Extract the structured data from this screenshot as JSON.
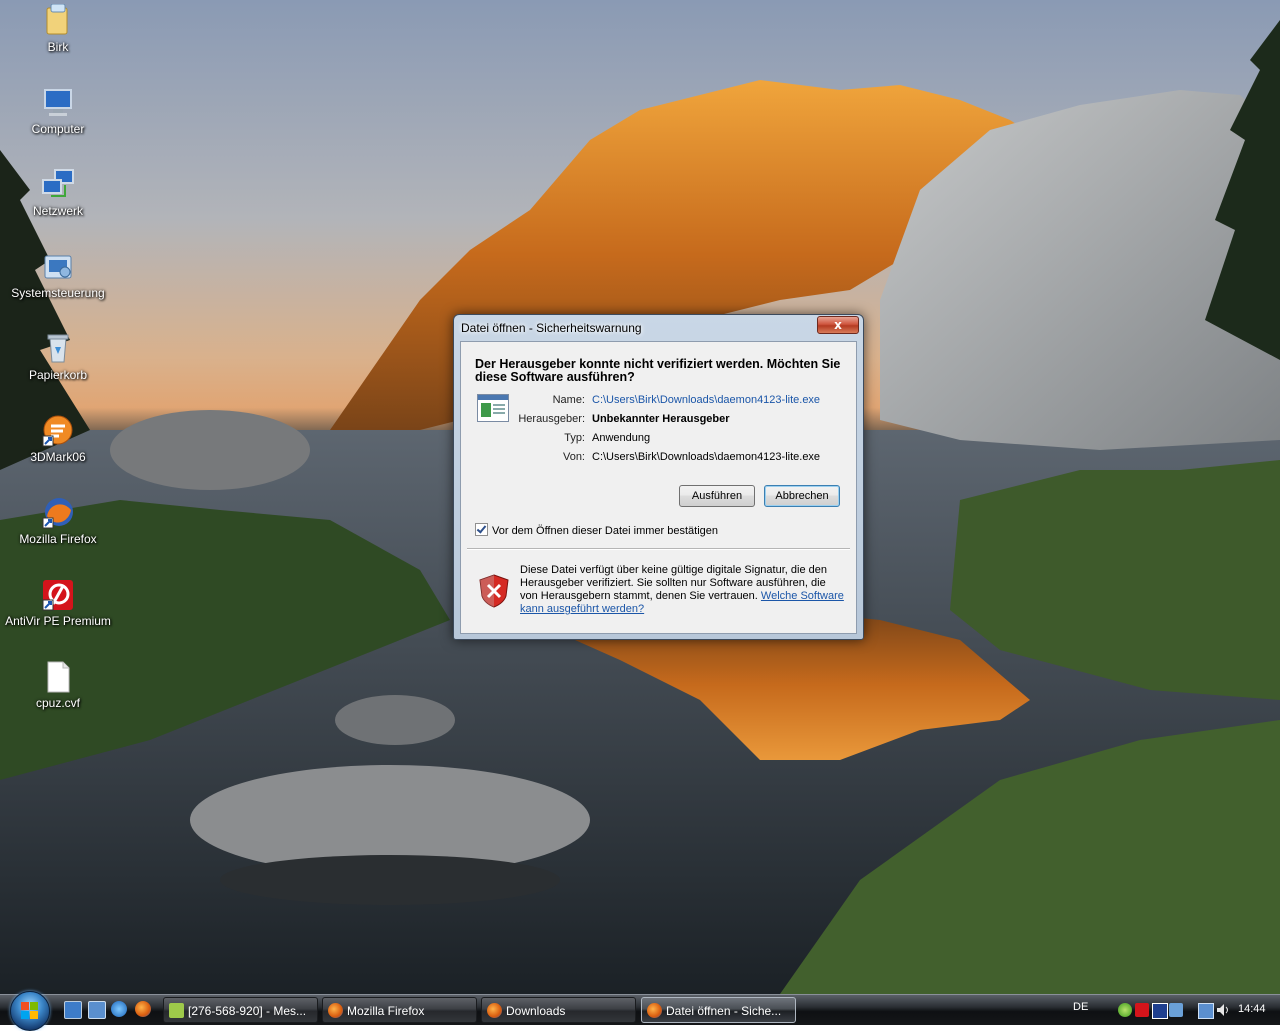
{
  "desktop": {
    "icons": [
      {
        "label": "Birk",
        "icon": "user-folder-icon"
      },
      {
        "label": "Computer",
        "icon": "computer-icon"
      },
      {
        "label": "Netzwerk",
        "icon": "network-icon"
      },
      {
        "label": "Systemsteuerung",
        "icon": "control-panel-icon"
      },
      {
        "label": "Papierkorb",
        "icon": "recycle-bin-icon"
      },
      {
        "label": "3DMark06",
        "icon": "3dmark-shortcut-icon"
      },
      {
        "label": "Mozilla Firefox",
        "icon": "firefox-shortcut-icon"
      },
      {
        "label": "AntiVir PE Premium",
        "icon": "antivir-shortcut-icon"
      },
      {
        "label": "cpuz.cvf",
        "icon": "file-icon"
      }
    ]
  },
  "dialog": {
    "title": "Datei öffnen - Sicherheitswarnung",
    "close_label": "x",
    "heading": "Der Herausgeber konnte nicht verifiziert werden. Möchten Sie diese Software ausführen?",
    "fields": {
      "name_label": "Name:",
      "name_value": "C:\\Users\\Birk\\Downloads\\daemon4123-lite.exe",
      "publisher_label": "Herausgeber:",
      "publisher_value": "Unbekannter Herausgeber",
      "type_label": "Typ:",
      "type_value": "Anwendung",
      "from_label": "Von:",
      "from_value": "C:\\Users\\Birk\\Downloads\\daemon4123-lite.exe"
    },
    "run_button": "Ausführen",
    "cancel_button": "Abbrechen",
    "checkbox_label": "Vor dem Öffnen dieser Datei immer bestätigen",
    "checkbox_checked": true,
    "warning_text": "Diese Datei verfügt über keine gültige digitale Signatur, die den Herausgeber verifiziert. Sie sollten nur Software ausführen, die von Herausgebern stammt, denen Sie vertrauen.",
    "warning_link": "Welche Software kann ausgeführt werden?"
  },
  "taskbar": {
    "tasks": [
      {
        "label": "[276-568-920] - Mes...",
        "icon": "messenger-icon",
        "active": false
      },
      {
        "label": "Mozilla Firefox",
        "icon": "firefox-icon",
        "active": false
      },
      {
        "label": "Downloads",
        "icon": "firefox-icon",
        "active": false
      },
      {
        "label": "Datei öffnen - Siche...",
        "icon": "firefox-icon",
        "active": true
      }
    ],
    "language": "DE",
    "clock": "14:44"
  },
  "colors": {
    "link": "#1b56a8",
    "close_button": "#c9452c",
    "taskbar": "#1a1c1f"
  }
}
